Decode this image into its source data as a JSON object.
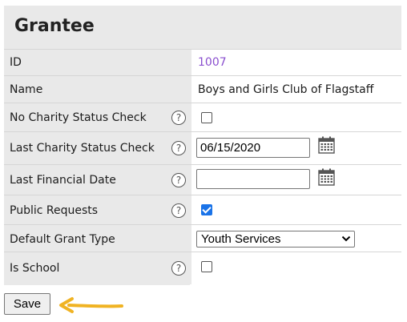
{
  "panel": {
    "title": "Grantee"
  },
  "rows": {
    "id": {
      "label": "ID",
      "value": "1007"
    },
    "name": {
      "label": "Name",
      "value": "Boys and Girls Club of Flagstaff"
    },
    "no_charity_status_check": {
      "label": "No Charity Status Check",
      "checked": false
    },
    "last_charity_status_check": {
      "label": "Last Charity Status Check",
      "value": "06/15/2020"
    },
    "last_financial_date": {
      "label": "Last Financial Date",
      "value": ""
    },
    "public_requests": {
      "label": "Public Requests",
      "checked": true
    },
    "default_grant_type": {
      "label": "Default Grant Type",
      "selected": "Youth Services"
    },
    "is_school": {
      "label": "Is School",
      "checked": false
    }
  },
  "help_glyph": "?",
  "icons": {
    "help": "help-circle-icon",
    "calendar": "calendar-icon",
    "chevron": "chevron-down-icon",
    "arrow": "arrow-left-icon"
  },
  "colors": {
    "panel_bg": "#e9e9e9",
    "link": "#8a4fcf",
    "checkbox_checked": "#1a73e8",
    "arrow": "#f0b323"
  },
  "save_button": {
    "label": "Save"
  }
}
